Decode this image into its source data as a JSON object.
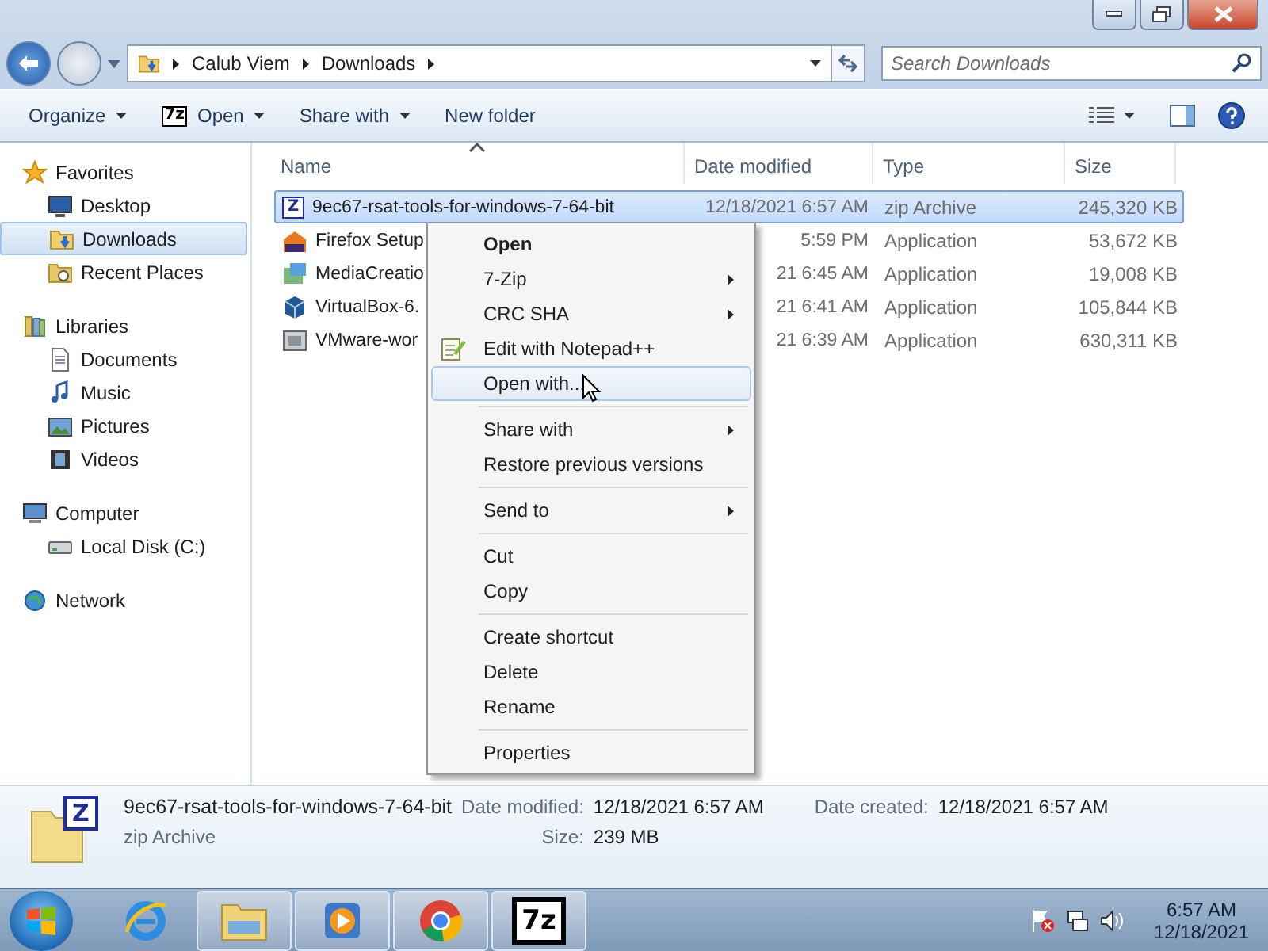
{
  "address": {
    "crumbs": [
      "Calub Viem",
      "Downloads"
    ]
  },
  "search": {
    "placeholder": "Search Downloads"
  },
  "toolbar": [
    {
      "label": "Organize",
      "has_menu": true
    },
    {
      "label": "Open",
      "has_menu": true,
      "icon_label": "7z"
    },
    {
      "label": "Share with",
      "has_menu": true
    },
    {
      "label": "New folder",
      "has_menu": false
    }
  ],
  "sidebar": {
    "groups": [
      {
        "label": "Favorites",
        "kind": "favorites",
        "items": [
          {
            "label": "Desktop",
            "kind": "desktop",
            "selected": false
          },
          {
            "label": "Downloads",
            "kind": "downloads",
            "selected": true
          },
          {
            "label": "Recent Places",
            "kind": "recent",
            "selected": false
          }
        ]
      },
      {
        "label": "Libraries",
        "kind": "libraries",
        "items": [
          {
            "label": "Documents",
            "kind": "documents",
            "selected": false
          },
          {
            "label": "Music",
            "kind": "music",
            "selected": false
          },
          {
            "label": "Pictures",
            "kind": "pictures",
            "selected": false
          },
          {
            "label": "Videos",
            "kind": "videos",
            "selected": false
          }
        ]
      },
      {
        "label": "Computer",
        "kind": "computer",
        "items": [
          {
            "label": "Local Disk (C:)",
            "kind": "disk",
            "selected": false
          }
        ]
      },
      {
        "label": "Network",
        "kind": "network"
      }
    ]
  },
  "table": {
    "columns": [
      {
        "label": "Name",
        "sorted": true
      },
      {
        "label": "Date modified",
        "sorted": false
      },
      {
        "label": "Type",
        "sorted": false
      },
      {
        "label": "Size",
        "sorted": false
      }
    ],
    "rows": [
      {
        "name": "9ec67-rsat-tools-for-windows-7-64-bit",
        "date": "12/18/2021 6:57 AM",
        "type": "zip Archive",
        "size": "245,320 KB",
        "kind": "zip",
        "icon_label": "Z",
        "selected": true
      },
      {
        "name": "Firefox Setup",
        "date": "5:59 PM",
        "type": "Application",
        "size": "53,672 KB",
        "kind": "firefox",
        "selected": false
      },
      {
        "name": "MediaCreatio",
        "date": "21 6:45 AM",
        "type": "Application",
        "size": "19,008 KB",
        "kind": "media",
        "selected": false
      },
      {
        "name": "VirtualBox-6.",
        "date": "21 6:41 AM",
        "type": "Application",
        "size": "105,844 KB",
        "kind": "virtualbox",
        "selected": false
      },
      {
        "name": "VMware-wor",
        "date": "21 6:39 AM",
        "type": "Application",
        "size": "630,311 KB",
        "kind": "vmware",
        "selected": false
      }
    ]
  },
  "context_menu": {
    "items": [
      {
        "kind": "item",
        "label": "Open",
        "bold": true,
        "submenu": false,
        "selected": false
      },
      {
        "kind": "item",
        "label": "7-Zip",
        "submenu": true,
        "selected": false
      },
      {
        "kind": "item",
        "label": "CRC SHA",
        "submenu": true,
        "selected": false
      },
      {
        "kind": "icon_item",
        "label": "Edit with Notepad++",
        "submenu": false,
        "selected": false
      },
      {
        "kind": "item",
        "label": "Open with...",
        "submenu": false,
        "selected": true
      },
      {
        "kind": "separator"
      },
      {
        "kind": "item",
        "label": "Share with",
        "submenu": true,
        "selected": false
      },
      {
        "kind": "item",
        "label": "Restore previous versions",
        "submenu": false,
        "selected": false
      },
      {
        "kind": "separator"
      },
      {
        "kind": "item",
        "label": "Send to",
        "submenu": true,
        "selected": false
      },
      {
        "kind": "separator"
      },
      {
        "kind": "item",
        "label": "Cut",
        "submenu": false,
        "selected": false
      },
      {
        "kind": "item",
        "label": "Copy",
        "submenu": false,
        "selected": false
      },
      {
        "kind": "separator"
      },
      {
        "kind": "item",
        "label": "Create shortcut",
        "submenu": false,
        "selected": false
      },
      {
        "kind": "item",
        "label": "Delete",
        "submenu": false,
        "selected": false
      },
      {
        "kind": "item",
        "label": "Rename",
        "submenu": false,
        "selected": false
      },
      {
        "kind": "separator"
      },
      {
        "kind": "item",
        "label": "Properties",
        "submenu": false,
        "selected": false
      }
    ]
  },
  "details": {
    "icon_label": "Z",
    "name": "9ec67-rsat-tools-for-windows-7-64-bit",
    "type": "zip Archive",
    "fields": [
      {
        "label": "Date modified:",
        "value": "12/18/2021 6:57 AM"
      },
      {
        "label": "Size:",
        "value": "239 MB"
      },
      {
        "label": "Date created:",
        "value": "12/18/2021 6:57 AM"
      }
    ]
  },
  "taskbar": {
    "apps": [
      {
        "kind": "ie",
        "running": false
      },
      {
        "kind": "explorer",
        "running": true
      },
      {
        "kind": "media",
        "running": true
      },
      {
        "kind": "chrome",
        "running": true
      },
      {
        "kind": "sevenzip",
        "running": true,
        "icon_label": "7z"
      }
    ],
    "clock": {
      "time": "6:57 AM",
      "date": "12/18/2021"
    }
  }
}
